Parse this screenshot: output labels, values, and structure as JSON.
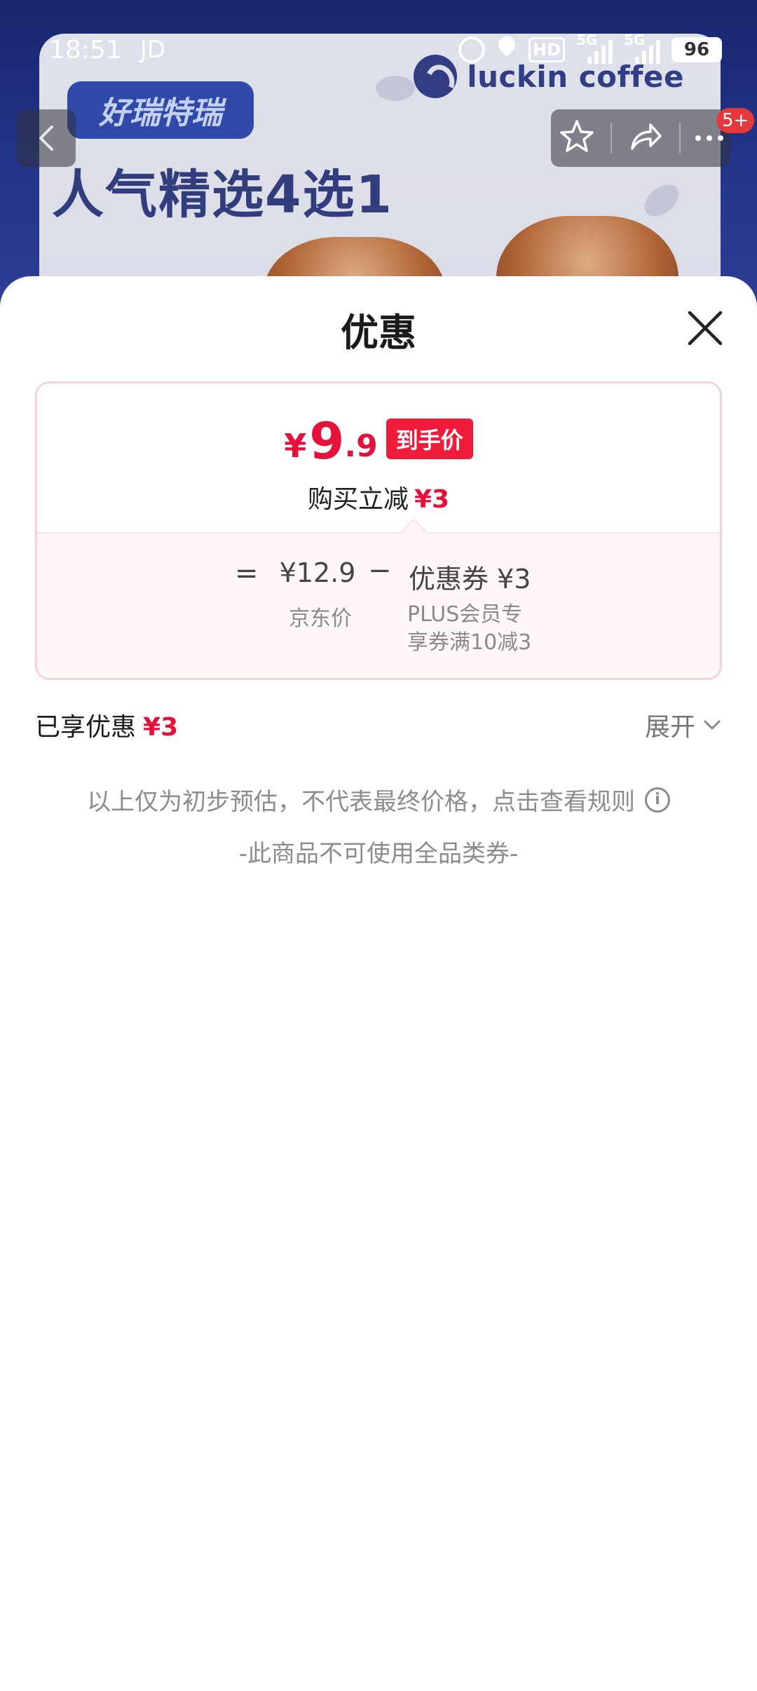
{
  "status_bar": {
    "time": "18:51",
    "carrier": "JD",
    "hd_label": "HD",
    "net1": "5G",
    "net2": "5G",
    "battery": "96"
  },
  "banner": {
    "brand": "luckin coffee",
    "tag": "好瑞特瑞",
    "headline": "人气精选4选1"
  },
  "nav": {
    "badge": "5+"
  },
  "sheet": {
    "title": "优惠",
    "final_price": {
      "currency": "¥",
      "integer": "9",
      "decimal": ".9"
    },
    "price_tag": "到手价",
    "instant_label": "购买立减",
    "instant_amount": "¥3",
    "calc": {
      "equals": "=",
      "jd_price": "¥12.9",
      "minus": "−",
      "coupon": "优惠券 ¥3",
      "jd_price_label": "京东价",
      "coupon_desc_line1": "PLUS会员专",
      "coupon_desc_line2": "享券满10减3"
    },
    "enjoyed_label": "已享优惠",
    "enjoyed_amount": "¥3",
    "expand_label": "展开",
    "note": "以上仅为初步预估，不代表最终价格，点击查看规则",
    "note2": "-此商品不可使用全品类券-"
  },
  "colors": {
    "accent_red": "#e4123a",
    "banner_blue": "#1f2d7a"
  }
}
